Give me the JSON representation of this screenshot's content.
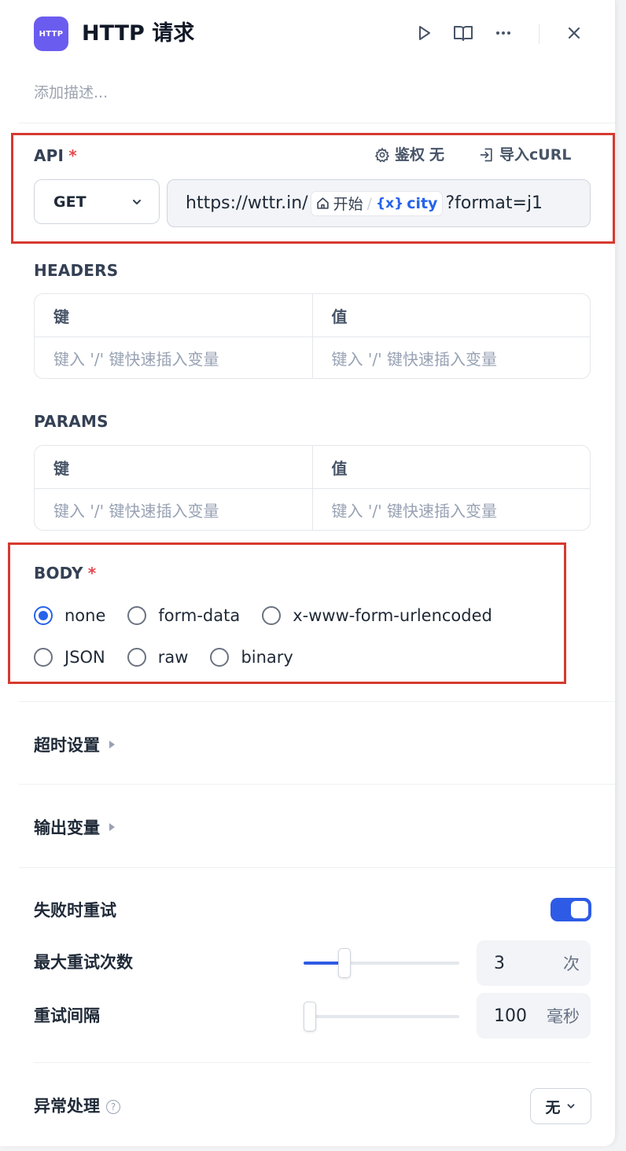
{
  "header": {
    "badge": "HTTP",
    "title": "HTTP 请求",
    "description_placeholder": "添加描述..."
  },
  "api": {
    "label": "API",
    "required_mark": "*",
    "auth_label": "鉴权",
    "auth_value": "无",
    "import_label": "导入cURL",
    "method": "GET",
    "url_prefix": "https://wttr.in/",
    "var_node": "开始",
    "var_name": "city",
    "url_suffix": "?format=j1"
  },
  "headers": {
    "label": "HEADERS",
    "key_header": "键",
    "value_header": "值",
    "key_placeholder": "键入 '/' 键快速插入变量",
    "value_placeholder": "键入 '/' 键快速插入变量"
  },
  "params": {
    "label": "PARAMS",
    "key_header": "键",
    "value_header": "值",
    "key_placeholder": "键入 '/' 键快速插入变量",
    "value_placeholder": "键入 '/' 键快速插入变量"
  },
  "body": {
    "label": "BODY",
    "required_mark": "*",
    "options": [
      "none",
      "form-data",
      "x-www-form-urlencoded",
      "JSON",
      "raw",
      "binary"
    ],
    "selected": "none"
  },
  "timeout": {
    "label": "超时设置"
  },
  "output_vars": {
    "label": "输出变量"
  },
  "retry": {
    "label": "失败时重试",
    "enabled": true,
    "max_retries_label": "最大重试次数",
    "max_retries_value": "3",
    "max_retries_unit": "次",
    "max_retries_fraction": 0.24,
    "interval_label": "重试间隔",
    "interval_value": "100",
    "interval_unit": "毫秒",
    "interval_fraction": 0.0
  },
  "error_handling": {
    "label": "异常处理",
    "value": "无"
  },
  "colors": {
    "accent": "#2e5be6",
    "badge": "#6b5cf0",
    "highlight_border": "#d63a2f",
    "variable": "#2563eb"
  }
}
